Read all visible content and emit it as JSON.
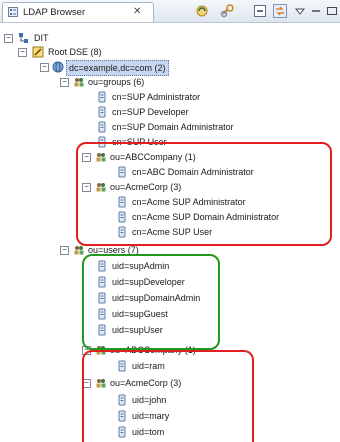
{
  "view": {
    "title": "LDAP Browser",
    "close_glyph": "✕"
  },
  "toolbar": {
    "icons": [
      "refresh-icon",
      "link-icon",
      "collapse-all-icon",
      "sync-icon",
      "view-menu-icon",
      "minimize-icon",
      "maximize-icon"
    ]
  },
  "tree": {
    "dit": "DIT",
    "root_dse": "Root DSE (8)",
    "domain": "dc=example,dc=com (2)",
    "groups": "ou=groups (6)",
    "g1": "cn=SUP Administrator",
    "g2": "cn=SUP Developer",
    "g3": "cn=SUP Domain Administrator",
    "g4": "cn=SUP User",
    "abc_groups": "ou=ABCCompany (1)",
    "abc_g1": "cn=ABC Domain Administrator",
    "acme_groups": "ou=AcmeCorp (3)",
    "acme_g1": "cn=Acme SUP Administrator",
    "acme_g2": "cn=Acme SUP Domain Administrator",
    "acme_g3": "cn=Acme SUP User",
    "users": "ou=users (7)",
    "u1": "uid=supAdmin",
    "u2": "uid=supDeveloper",
    "u3": "uid=supDomainAdmin",
    "u4": "uid=supGuest",
    "u5": "uid=supUser",
    "abc_users": "ou=ABCCompany (1)",
    "abc_u1": "uid=ram",
    "acme_users": "ou=AcmeCorp (3)",
    "acme_u1": "uid=john",
    "acme_u2": "uid=mary",
    "acme_u3": "uid=tom"
  },
  "colors": {
    "red_highlight": "#e02020",
    "green_highlight": "#1e9a1e",
    "selection": "#c7d7ef"
  }
}
